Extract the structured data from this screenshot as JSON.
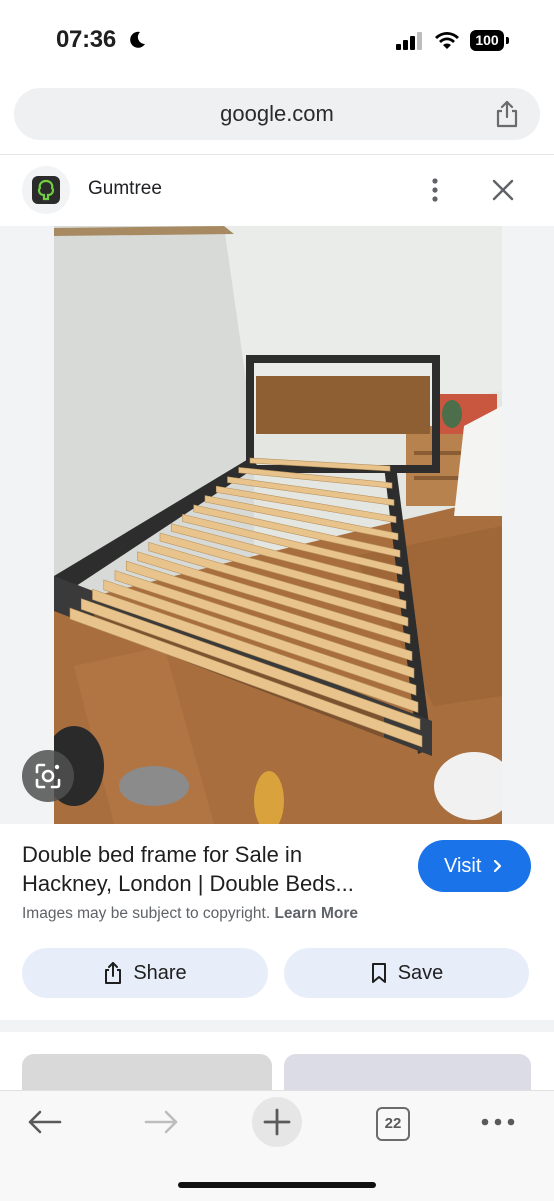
{
  "status_bar": {
    "time": "07:36",
    "battery": "100"
  },
  "browser": {
    "url": "google.com",
    "tab_count": "22"
  },
  "result": {
    "site_name": "Gumtree",
    "title_line1": "Double bed frame for Sale in",
    "title_line2": "Hackney, London | Double Beds...",
    "visit_label": "Visit",
    "copyright_text": "Images may be subject to copyright.",
    "learn_more_label": "Learn More",
    "share_label": "Share",
    "save_label": "Save"
  },
  "colors": {
    "accent": "#1a73e8",
    "pill_bg": "#e8eef9",
    "logo_green": "#6fcf3f"
  },
  "icons": [
    "moon-icon",
    "signal-icon",
    "wifi-icon",
    "battery-icon",
    "share-icon",
    "gumtree-logo",
    "more-vert-icon",
    "close-icon",
    "google-lens-icon",
    "chevron-right-icon",
    "bookmark-icon",
    "back-arrow-icon",
    "forward-arrow-icon",
    "new-tab-icon",
    "tabs-icon",
    "more-horiz-icon"
  ]
}
